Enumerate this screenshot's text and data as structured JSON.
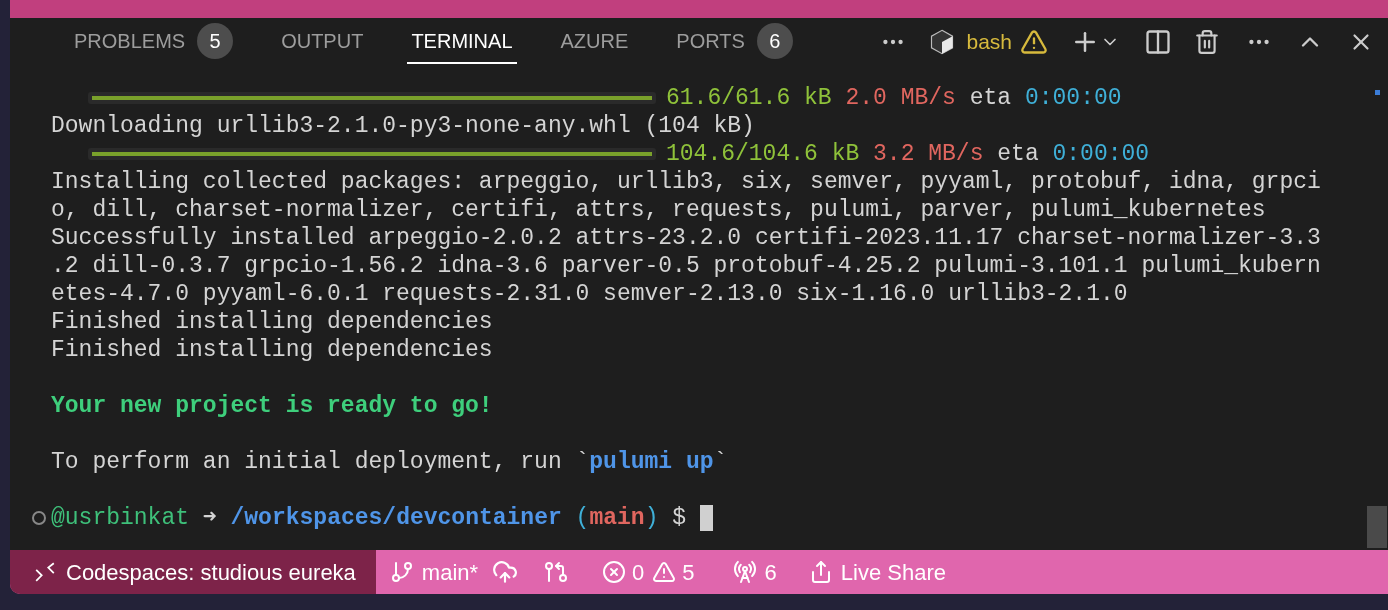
{
  "panel_tabs": [
    {
      "label": "PROBLEMS",
      "badge": "5",
      "selected": false
    },
    {
      "label": "OUTPUT",
      "selected": false
    },
    {
      "label": "TERMINAL",
      "selected": true
    },
    {
      "label": "AZURE",
      "selected": false
    },
    {
      "label": "PORTS",
      "badge": "6",
      "selected": false
    }
  ],
  "terminal_toolbar": {
    "shell": "bash"
  },
  "terminal_lines": [
    {
      "kind": "progress",
      "level": 1,
      "segments": [
        {
          "kind": "size",
          "text": "61.6/61.6 kB"
        },
        {
          "kind": "rate",
          "text": "2.0 MB/s"
        },
        {
          "kind": "plain",
          "text": "eta"
        },
        {
          "kind": "eta",
          "text": "0:00:00"
        }
      ]
    },
    {
      "kind": "text",
      "segments": [
        {
          "kind": "plain",
          "text": "Downloading urllib3-2.1.0-py3-none-any.whl (104 kB)"
        }
      ]
    },
    {
      "kind": "progress",
      "level": 1,
      "segments": [
        {
          "kind": "size",
          "text": "104.6/104.6 kB"
        },
        {
          "kind": "rate",
          "text": "3.2 MB/s"
        },
        {
          "kind": "plain",
          "text": "eta"
        },
        {
          "kind": "eta",
          "text": "0:00:00"
        }
      ]
    },
    {
      "kind": "text",
      "segments": [
        {
          "kind": "plain",
          "text": "Installing collected packages: arpeggio, urllib3, six, semver, pyyaml, protobuf, idna, grpci"
        }
      ]
    },
    {
      "kind": "text",
      "segments": [
        {
          "kind": "plain",
          "text": "o, dill, charset-normalizer, certifi, attrs, requests, pulumi, parver, pulumi_kubernetes"
        }
      ]
    },
    {
      "kind": "text",
      "segments": [
        {
          "kind": "plain",
          "text": "Successfully installed arpeggio-2.0.2 attrs-23.2.0 certifi-2023.11.17 charset-normalizer-3.3"
        }
      ]
    },
    {
      "kind": "text",
      "segments": [
        {
          "kind": "plain",
          "text": ".2 dill-0.3.7 grpcio-1.56.2 idna-3.6 parver-0.5 protobuf-4.25.2 pulumi-3.101.1 pulumi_kubern"
        }
      ]
    },
    {
      "kind": "text",
      "segments": [
        {
          "kind": "plain",
          "text": "etes-4.7.0 pyyaml-6.0.1 requests-2.31.0 semver-2.13.0 six-1.16.0 urllib3-2.1.0"
        }
      ]
    },
    {
      "kind": "text",
      "segments": [
        {
          "kind": "plain",
          "text": "Finished installing dependencies"
        }
      ]
    },
    {
      "kind": "text",
      "segments": [
        {
          "kind": "plain",
          "text": "Finished installing dependencies"
        }
      ]
    },
    {
      "kind": "blank"
    },
    {
      "kind": "text",
      "segments": [
        {
          "kind": "success",
          "text": "Your new project is ready to go!"
        }
      ]
    },
    {
      "kind": "blank"
    },
    {
      "kind": "text",
      "segments": [
        {
          "kind": "plain",
          "text": "To perform an initial deployment, run `"
        },
        {
          "kind": "command",
          "text": "pulumi up"
        },
        {
          "kind": "plain",
          "text": "`"
        }
      ]
    },
    {
      "kind": "blank"
    }
  ],
  "prompt": {
    "user": "@usrbinkat",
    "arrow": "➜",
    "path": "/workspaces/devcontainer",
    "branch_open": "(",
    "branch": "main",
    "branch_close": ")",
    "symbol": "$"
  },
  "status_bar": {
    "remote": "Codespaces: studious eureka",
    "branch": "main*",
    "errors": "0",
    "warnings": "5",
    "ports": "6",
    "live_share": "Live Share"
  }
}
